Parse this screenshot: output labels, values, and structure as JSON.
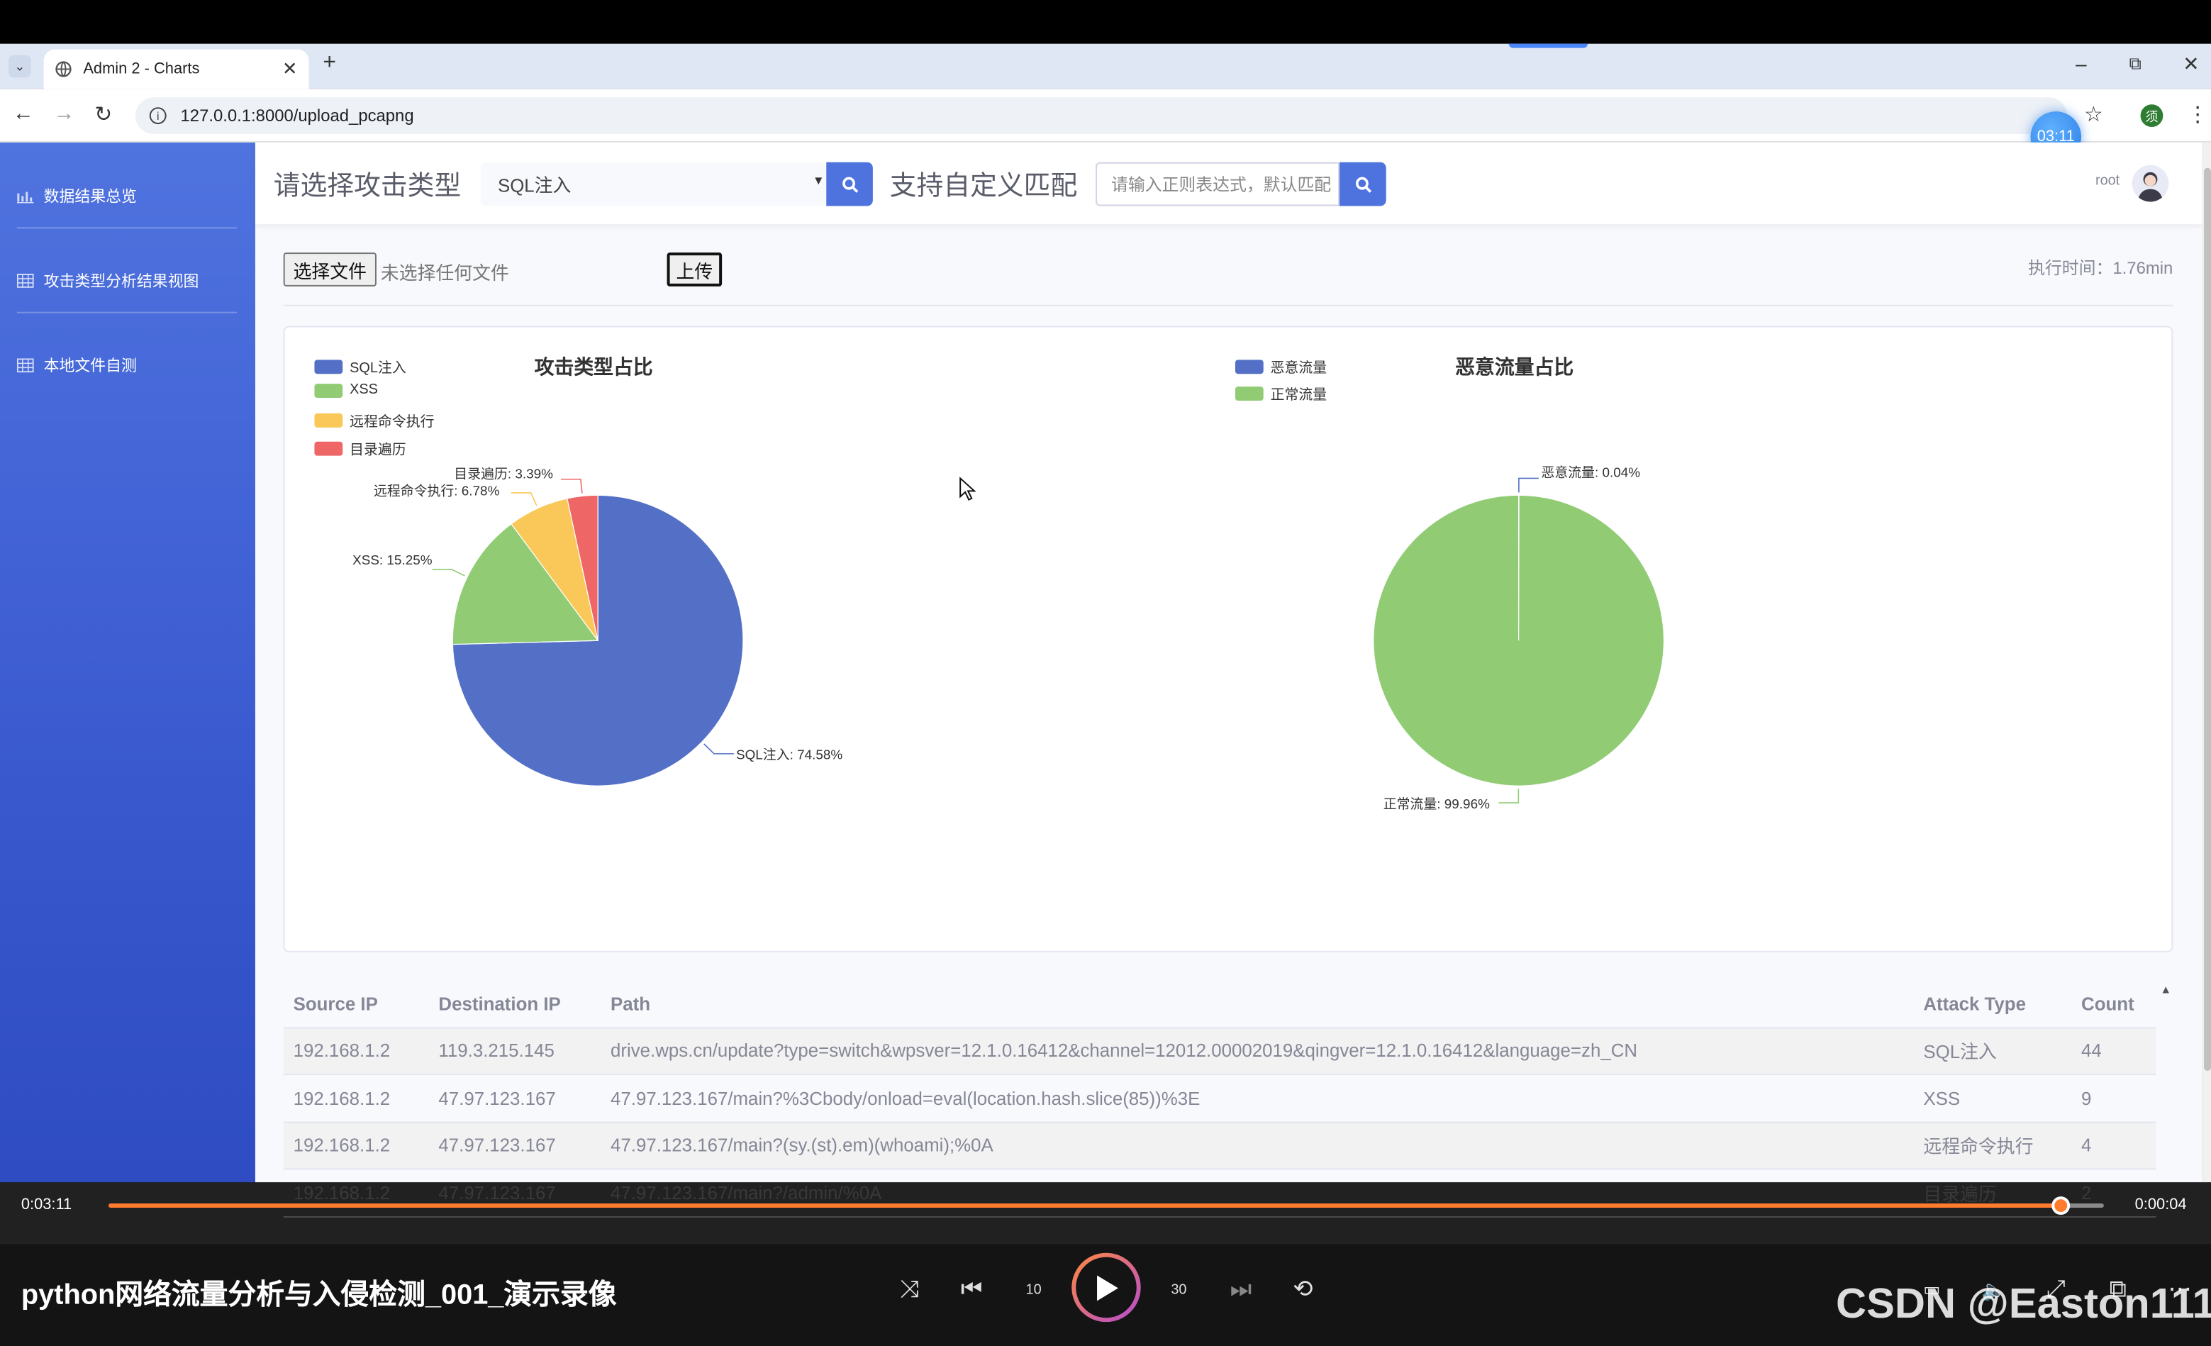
{
  "browser": {
    "tab_title": "Admin 2 - Charts",
    "url": "127.0.0.1:8000/upload_pcapng",
    "profile_initial": "须",
    "timer_badge": "03:11"
  },
  "sidebar": {
    "items": [
      {
        "label": "数据结果总览"
      },
      {
        "label": "攻击类型分析结果视图"
      },
      {
        "label": "本地文件自测"
      }
    ]
  },
  "topbar": {
    "attack_select_title": "请选择攻击类型",
    "attack_select_value": "SQL注入",
    "custom_match_title": "支持自定义匹配",
    "regex_placeholder": "请输入正则表达式，默认匹配",
    "username": "root"
  },
  "upload": {
    "choose_file_label": "选择文件",
    "no_file_text": "未选择任何文件",
    "upload_label": "上传",
    "exec_time": "执行时间：1.76min"
  },
  "chart_data": [
    {
      "type": "pie",
      "title": "攻击类型占比",
      "legend_position": "top-left",
      "categories": [
        "SQL注入",
        "XSS",
        "远程命令执行",
        "目录遍历"
      ],
      "values": [
        74.58,
        15.25,
        6.78,
        3.39
      ],
      "colors": [
        "#5470c6",
        "#91cc75",
        "#fac858",
        "#ee6666"
      ],
      "labels": [
        "SQL注入: 74.58%",
        "XSS: 15.25%",
        "远程命令执行: 6.78%",
        "目录遍历: 3.39%"
      ]
    },
    {
      "type": "pie",
      "title": "恶意流量占比",
      "legend_position": "top-left",
      "categories": [
        "恶意流量",
        "正常流量"
      ],
      "values": [
        0.04,
        99.96
      ],
      "colors": [
        "#5470c6",
        "#91cc75"
      ],
      "labels": [
        "恶意流量: 0.04%",
        "正常流量: 99.96%"
      ]
    }
  ],
  "table": {
    "columns": [
      "Source IP",
      "Destination IP",
      "Path",
      "Attack Type",
      "Count"
    ],
    "rows": [
      [
        "192.168.1.2",
        "119.3.215.145",
        "drive.wps.cn/update?type=switch&wpsver=12.1.0.16412&channel=12012.00002019&qingver=12.1.0.16412&language=zh_CN",
        "SQL注入",
        "44"
      ],
      [
        "192.168.1.2",
        "47.97.123.167",
        "47.97.123.167/main?%3Cbody/onload=eval(location.hash.slice(85))%3E",
        "XSS",
        "9"
      ],
      [
        "192.168.1.2",
        "47.97.123.167",
        "47.97.123.167/main?(sy.(st).em)(whoami);%0A",
        "远程命令执行",
        "4"
      ],
      [
        "192.168.1.2",
        "47.97.123.167",
        "47.97.123.167/main?/admin/%0A",
        "目录遍历",
        "2"
      ]
    ]
  },
  "player": {
    "elapsed": "0:03:11",
    "remaining": "0:00:04",
    "progress": 0.9783,
    "video_title": "python网络流量分析与入侵检测_001_演示录像",
    "watermark": "CSDN @Easton111",
    "rewind_label": "10",
    "forward_label": "30"
  }
}
